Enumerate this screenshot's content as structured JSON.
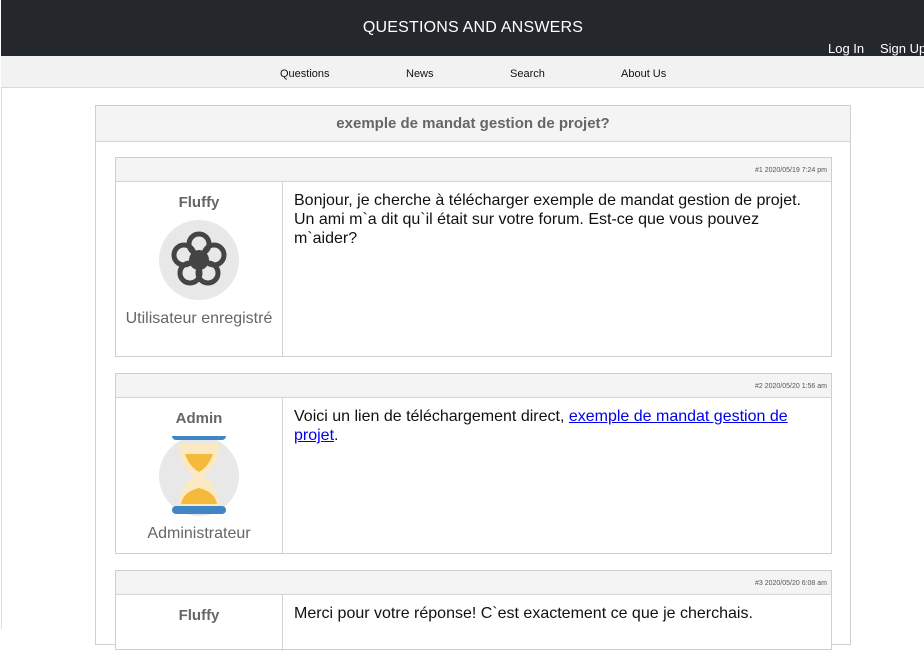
{
  "site": {
    "title": "QUESTIONS AND ANSWERS",
    "login_label": "Log In",
    "signup_label": "Sign Up"
  },
  "nav": {
    "items": [
      {
        "label": "Questions"
      },
      {
        "label": "News"
      },
      {
        "label": "Search"
      },
      {
        "label": "About Us"
      }
    ]
  },
  "thread": {
    "title": "exemple de mandat gestion de projet?",
    "posts": [
      {
        "meta": "#1 2020/05/19 7:24 pm",
        "author": "Fluffy",
        "avatar_icon": "flower-icon",
        "role": "Utilisateur enregistré",
        "message": "Bonjour, je cherche à télécharger exemple de mandat gestion de projet. Un ami m`a dit qu`il était sur votre forum. Est-ce que vous pouvez m`aider?"
      },
      {
        "meta": "#2 2020/05/20 1:56 am",
        "author": "Admin",
        "avatar_icon": "hourglass-icon",
        "role": "Administrateur",
        "message_prefix": "Voici un lien de téléchargement direct, ",
        "link_text": "exemple de mandat gestion de projet",
        "message_suffix": "."
      },
      {
        "meta": "#3 2020/05/20 6:08 am",
        "author": "Fluffy",
        "message": "Merci pour votre réponse! C`est exactement ce que je cherchais."
      }
    ]
  },
  "colors": {
    "topbar": "#24282c",
    "navbar": "#f2f2f2",
    "link": "#0000ee",
    "hourglass_blue": "#3f86c4",
    "hourglass_sand": "#f5b93c"
  }
}
